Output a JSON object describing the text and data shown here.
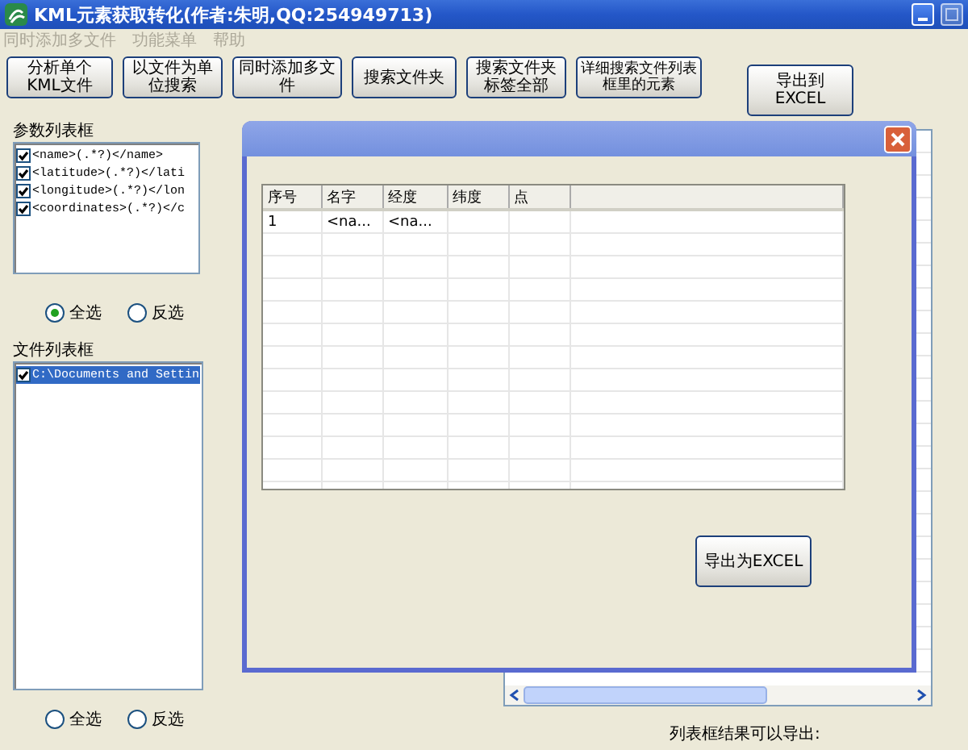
{
  "window": {
    "title": "KML元素获取转化(作者:朱明,QQ:254949713)"
  },
  "menu": [
    {
      "label": "同时添加多文件",
      "disabled": true
    },
    {
      "label": "功能菜单",
      "disabled": true
    },
    {
      "label": "帮助",
      "disabled": true
    }
  ],
  "toolbar": [
    "分析单个KML文件",
    "以文件为单位搜索",
    "同时添加多文件",
    "搜索文件夹",
    "搜索文件夹标签全部",
    "详细搜索文件列表框里的元素"
  ],
  "export_button": "导出到EXCEL",
  "param_list": {
    "label": "参数列表框",
    "items": [
      {
        "text": "<name>(.*?)</name>",
        "checked": true
      },
      {
        "text": "<latitude>(.*?)</lati",
        "checked": true
      },
      {
        "text": "<longitude>(.*?)</lon",
        "checked": true
      },
      {
        "text": "<coordinates>(.*?)</c",
        "checked": true
      }
    ]
  },
  "param_radios": [
    {
      "label": "全选",
      "selected": true
    },
    {
      "label": "反选",
      "selected": false
    }
  ],
  "file_list": {
    "label": "文件列表框",
    "items": [
      {
        "text": "C:\\Documents and Settin",
        "checked": true,
        "selected": true
      }
    ]
  },
  "file_radios": [
    {
      "label": "全选",
      "selected": false
    },
    {
      "label": "反选",
      "selected": false
    }
  ],
  "status_label": "列表框结果可以导出:",
  "dialog": {
    "table": {
      "columns": [
        "序号",
        "名字",
        "经度",
        "纬度",
        "点"
      ],
      "rows": [
        {
          "cells": [
            "1",
            "<na...",
            "<na..."
          ]
        }
      ]
    },
    "export_button": "导出为EXCEL"
  }
}
